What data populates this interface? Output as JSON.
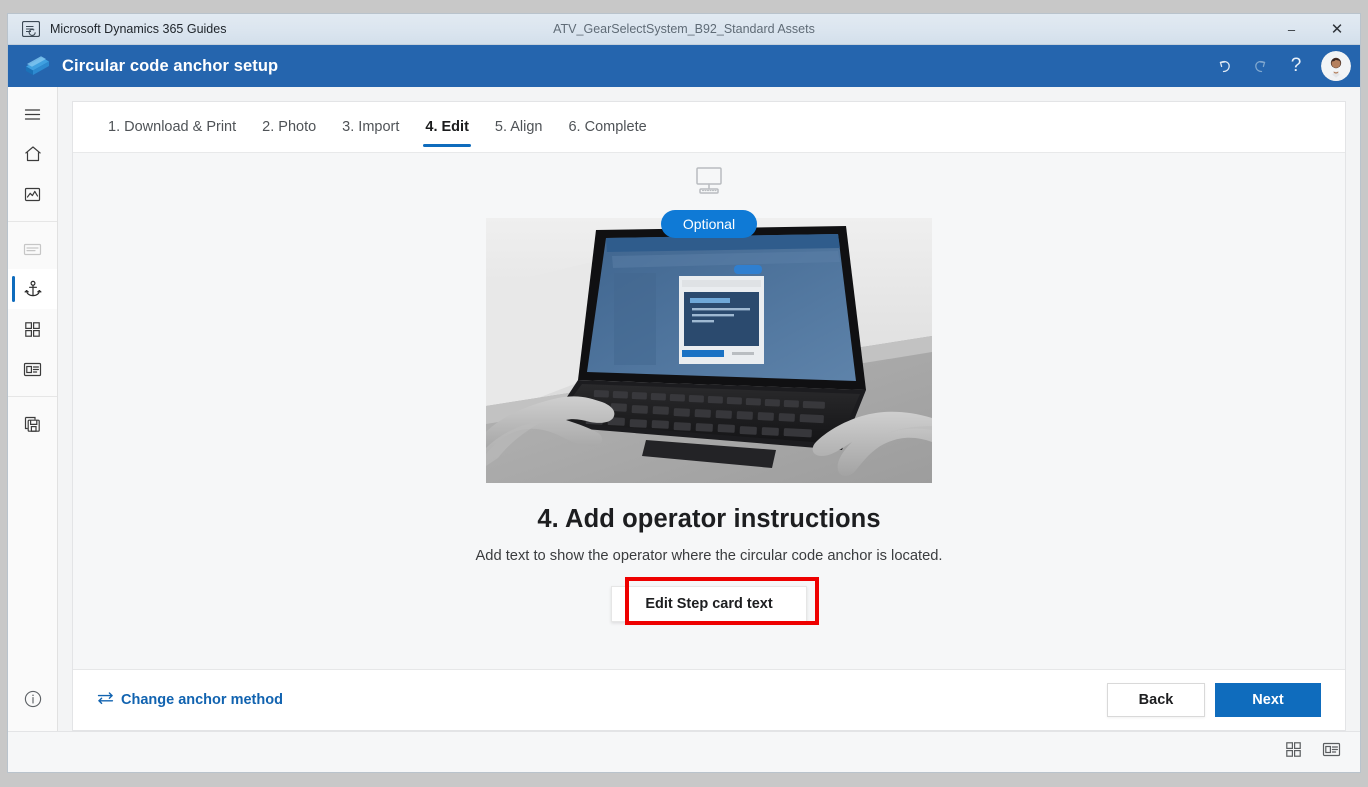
{
  "titlebar": {
    "app_icon": "guides-app-icon",
    "app_name": "Microsoft Dynamics 365 Guides",
    "document_name": "ATV_GearSelectSystem_B92_Standard Assets",
    "minimize_label": "–",
    "close_label": "✕"
  },
  "header": {
    "logo": "dynamics-guides-logo",
    "title": "Circular code anchor setup",
    "accent_color": "#2565ae",
    "actions": [
      {
        "name": "undo-icon",
        "label": "Undo",
        "state": "enabled"
      },
      {
        "name": "redo-icon",
        "label": "Redo",
        "state": "disabled"
      },
      {
        "name": "help-icon",
        "label": "?",
        "state": "enabled"
      }
    ],
    "avatar": {
      "name": "user-avatar",
      "label": "Account"
    }
  },
  "sidebar": {
    "items": [
      {
        "name": "menu-icon",
        "label": "Menu",
        "state": "enabled"
      },
      {
        "name": "home-icon",
        "label": "Home",
        "state": "enabled"
      },
      {
        "name": "outline-icon",
        "label": "Outline",
        "state": "enabled"
      },
      {
        "name": "step-card-icon",
        "label": "Step card",
        "state": "disabled"
      },
      {
        "name": "anchor-icon",
        "label": "Anchor",
        "state": "selected"
      },
      {
        "name": "grid-icon",
        "label": "Assets",
        "state": "enabled"
      },
      {
        "name": "media-card-icon",
        "label": "Media",
        "state": "enabled"
      },
      {
        "name": "copy-icon",
        "label": "Duplicate",
        "state": "enabled"
      }
    ],
    "bottom": {
      "name": "info-icon",
      "label": "Information"
    }
  },
  "tabs": [
    {
      "label": "1. Download & Print",
      "active": false
    },
    {
      "label": "2. Photo",
      "active": false
    },
    {
      "label": "3. Import",
      "active": false
    },
    {
      "label": "4. Edit",
      "active": true
    },
    {
      "label": "5. Align",
      "active": false
    },
    {
      "label": "6. Complete",
      "active": false
    }
  ],
  "stage": {
    "device_icon": "desktop-monitor-icon",
    "badge": "Optional",
    "badge_color": "#0f7ad6",
    "illustration": "laptop-typing-photo",
    "headline": "4. Add operator instructions",
    "description": "Add text to show the operator where the circular code anchor is located.",
    "primary_action": "Edit Step card text",
    "annotation": {
      "name": "red-highlight-box",
      "color": "#ee0000"
    }
  },
  "footer": {
    "change_method_icon": "swap-arrows-icon",
    "change_method": "Change anchor method",
    "back": "Back",
    "next": "Next",
    "next_color": "#0f6cbd"
  },
  "statusbar": {
    "icons": [
      {
        "name": "grid-view-icon",
        "label": "Grid view"
      },
      {
        "name": "card-view-icon",
        "label": "Card view"
      }
    ]
  }
}
